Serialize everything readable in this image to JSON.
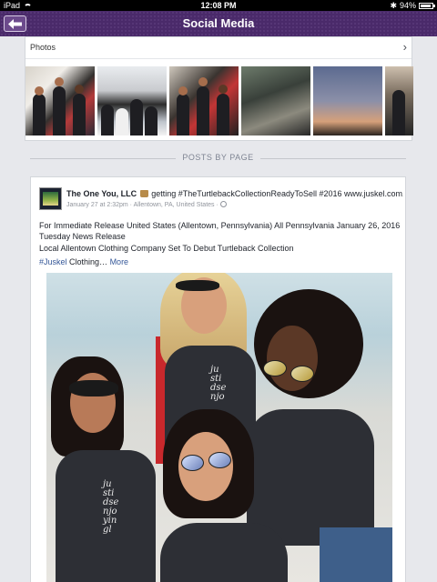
{
  "status_bar": {
    "carrier": "iPad",
    "time": "12:08 PM",
    "battery": "94%"
  },
  "nav": {
    "title": "Social Media"
  },
  "photos": {
    "label": "Photos"
  },
  "divider": {
    "label": "POSTS BY PAGE"
  },
  "post": {
    "author": "The One You, LLC",
    "activity": "getting #TheTurtlebackCollectionReadyToSell #2016 www.juskel.com.",
    "date": "January 27 at 2:32pm",
    "location": "Allentown, PA, United States",
    "body_line1": "For Immediate Release United States (Allentown, Pennsylvania) All Pennsylvania January 26, 2016",
    "body_line2": "Tuesday News Release",
    "body_line3": "Local Allentown Clothing Company Set To Debut Turtleback Collection",
    "hashtag": "#Juskel",
    "tail": " Clothing…",
    "more": "More"
  },
  "colors": {
    "nav_bg": "#4a2a6a",
    "link": "#365899"
  }
}
